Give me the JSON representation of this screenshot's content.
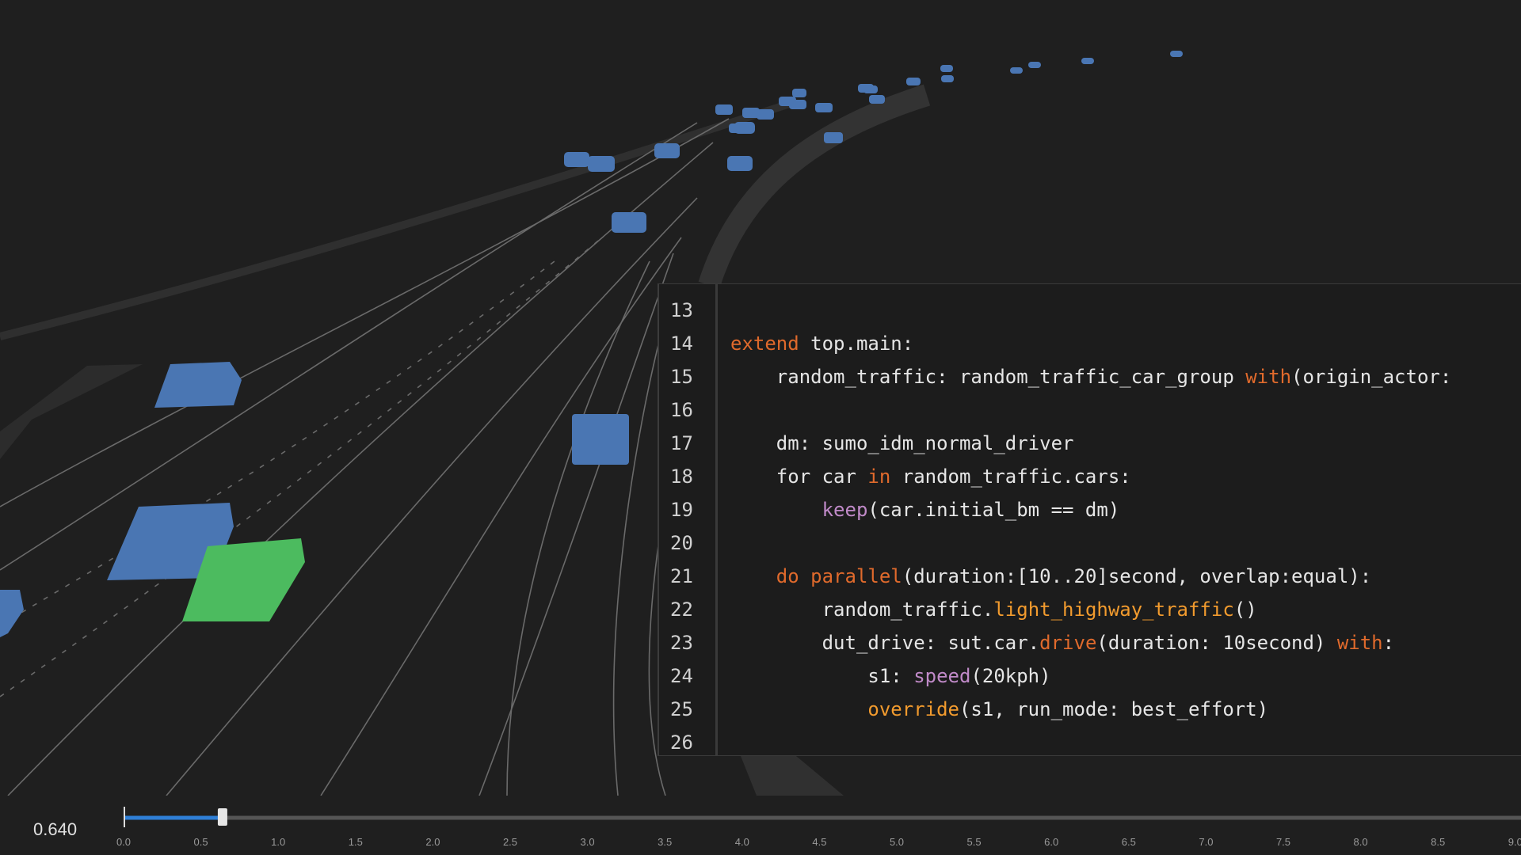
{
  "editor": {
    "lines": [
      {
        "num": "13",
        "tokens": []
      },
      {
        "num": "14",
        "tokens": [
          {
            "t": "extend",
            "c": "kw"
          },
          {
            "t": " top.main:",
            "c": ""
          }
        ]
      },
      {
        "num": "15",
        "tokens": [
          {
            "t": "    random_traffic: random_traffic_car_group ",
            "c": ""
          },
          {
            "t": "with",
            "c": "kw"
          },
          {
            "t": "(origin_actor:",
            "c": ""
          }
        ]
      },
      {
        "num": "16",
        "tokens": []
      },
      {
        "num": "17",
        "tokens": [
          {
            "t": "    dm: sumo_idm_normal_driver",
            "c": ""
          }
        ]
      },
      {
        "num": "18",
        "tokens": [
          {
            "t": "    for car ",
            "c": ""
          },
          {
            "t": "in",
            "c": "kw"
          },
          {
            "t": " random_traffic.cars:",
            "c": ""
          }
        ]
      },
      {
        "num": "19",
        "tokens": [
          {
            "t": "        ",
            "c": ""
          },
          {
            "t": "keep",
            "c": "bi"
          },
          {
            "t": "(car.initial_bm == dm)",
            "c": ""
          }
        ]
      },
      {
        "num": "20",
        "tokens": []
      },
      {
        "num": "21",
        "tokens": [
          {
            "t": "    ",
            "c": ""
          },
          {
            "t": "do",
            "c": "kw"
          },
          {
            "t": " ",
            "c": ""
          },
          {
            "t": "parallel",
            "c": "kw"
          },
          {
            "t": "(duration:[10..20]second, overlap:equal):",
            "c": ""
          }
        ]
      },
      {
        "num": "22",
        "tokens": [
          {
            "t": "        random_traffic.",
            "c": ""
          },
          {
            "t": "light_highway_traffic",
            "c": "fn"
          },
          {
            "t": "()",
            "c": ""
          }
        ]
      },
      {
        "num": "23",
        "tokens": [
          {
            "t": "        dut_drive: sut.car.",
            "c": ""
          },
          {
            "t": "drive",
            "c": "kw"
          },
          {
            "t": "(duration: 10second) ",
            "c": ""
          },
          {
            "t": "with",
            "c": "kw"
          },
          {
            "t": ":",
            "c": ""
          }
        ]
      },
      {
        "num": "24",
        "tokens": [
          {
            "t": "            s1: ",
            "c": ""
          },
          {
            "t": "speed",
            "c": "bi"
          },
          {
            "t": "(20kph)",
            "c": ""
          }
        ]
      },
      {
        "num": "25",
        "tokens": [
          {
            "t": "            ",
            "c": ""
          },
          {
            "t": "override",
            "c": "fn"
          },
          {
            "t": "(s1, run_mode: best_effort)",
            "c": ""
          }
        ]
      },
      {
        "num": "26",
        "tokens": []
      }
    ]
  },
  "timeline": {
    "current_value": "0.640",
    "progress_fraction": 0.064,
    "min": 0.0,
    "max": 10.0,
    "ticks": [
      "0.0",
      "0.5",
      "1.0",
      "1.5",
      "2.0",
      "2.5",
      "3.0",
      "3.5",
      "4.0",
      "4.5",
      "5.0",
      "5.5",
      "6.0",
      "6.5",
      "7.0",
      "7.5",
      "8.0",
      "8.5",
      "9.0"
    ]
  },
  "scene": {
    "colors": {
      "background": "#1f1f1f",
      "traffic_car": "#4a76b3",
      "ego_car": "#4cbb5f",
      "lane_line": "#6b6b6b",
      "road_shoulder": "#2e2e2e"
    },
    "traffic_car_count": 29,
    "ego_car_count": 1
  }
}
